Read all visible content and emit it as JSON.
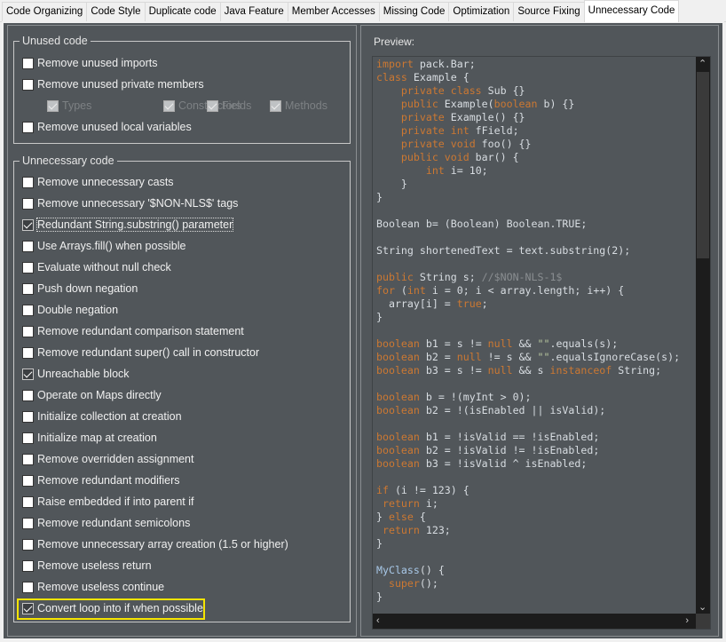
{
  "tabs": [
    "Code Organizing",
    "Code Style",
    "Duplicate code",
    "Java Feature",
    "Member Accesses",
    "Missing Code",
    "Optimization",
    "Source Fixing",
    "Unnecessary Code"
  ],
  "selected_tab": "Unnecessary Code",
  "unused": {
    "title": "Unused code",
    "items": [
      {
        "label": "Remove unused imports",
        "checked": false
      },
      {
        "label": "Remove unused private members",
        "checked": false
      },
      {
        "label": "Remove unused local variables",
        "checked": false
      }
    ],
    "sub": [
      {
        "label": "Types",
        "checked": true
      },
      {
        "label": "Constructors",
        "checked": true
      },
      {
        "label": "Fields",
        "checked": true
      },
      {
        "label": "Methods",
        "checked": true
      }
    ]
  },
  "unnecessary": {
    "title": "Unnecessary code",
    "items": [
      {
        "label": "Remove unnecessary casts",
        "checked": false
      },
      {
        "label": "Remove unnecessary '$NON-NLS$' tags",
        "checked": false
      },
      {
        "label": "Redundant String.substring() parameter",
        "checked": true
      },
      {
        "label": "Use Arrays.fill() when possible",
        "checked": false
      },
      {
        "label": "Evaluate without null check",
        "checked": false
      },
      {
        "label": "Push down negation",
        "checked": false
      },
      {
        "label": "Double negation",
        "checked": false
      },
      {
        "label": "Remove redundant comparison statement",
        "checked": false
      },
      {
        "label": "Remove redundant super() call in constructor",
        "checked": false
      },
      {
        "label": "Unreachable block",
        "checked": true
      },
      {
        "label": "Operate on Maps directly",
        "checked": false
      },
      {
        "label": "Initialize collection at creation",
        "checked": false
      },
      {
        "label": "Initialize map at creation",
        "checked": false
      },
      {
        "label": "Remove overridden assignment",
        "checked": false
      },
      {
        "label": "Remove redundant modifiers",
        "checked": false
      },
      {
        "label": "Raise embedded if into parent if",
        "checked": false
      },
      {
        "label": "Remove redundant semicolons",
        "checked": false
      },
      {
        "label": "Remove unnecessary array creation (1.5 or higher)",
        "checked": false
      },
      {
        "label": "Remove useless return",
        "checked": false
      },
      {
        "label": "Remove useless continue",
        "checked": false
      },
      {
        "label": "Convert loop into if when possible",
        "checked": true
      }
    ]
  },
  "preview": {
    "label": "Preview:",
    "lines": [
      [
        [
          "k",
          "import"
        ],
        [
          "t",
          " pack.Bar;"
        ]
      ],
      [
        [
          "k",
          "class"
        ],
        [
          "t",
          " Example {"
        ]
      ],
      [
        [
          "t",
          "    "
        ],
        [
          "k",
          "private class"
        ],
        [
          "t",
          " Sub {}"
        ]
      ],
      [
        [
          "t",
          "    "
        ],
        [
          "k",
          "public"
        ],
        [
          "t",
          " Example("
        ],
        [
          "k",
          "boolean"
        ],
        [
          "t",
          " b) {}"
        ]
      ],
      [
        [
          "t",
          "    "
        ],
        [
          "k",
          "private"
        ],
        [
          "t",
          " Example() {}"
        ]
      ],
      [
        [
          "t",
          "    "
        ],
        [
          "k",
          "private int"
        ],
        [
          "t",
          " fField;"
        ]
      ],
      [
        [
          "t",
          "    "
        ],
        [
          "k",
          "private void"
        ],
        [
          "t",
          " foo() {}"
        ]
      ],
      [
        [
          "t",
          "    "
        ],
        [
          "k",
          "public void"
        ],
        [
          "t",
          " bar() {"
        ]
      ],
      [
        [
          "t",
          "        "
        ],
        [
          "k",
          "int"
        ],
        [
          "t",
          " i= 10;"
        ]
      ],
      [
        [
          "t",
          "    }"
        ]
      ],
      [
        [
          "t",
          "}"
        ]
      ],
      [],
      [
        [
          "t",
          "Boolean b= (Boolean) Boolean.TRUE;"
        ]
      ],
      [],
      [
        [
          "t",
          "String shortenedText = text.substring(2);"
        ]
      ],
      [],
      [
        [
          "k",
          "public"
        ],
        [
          "t",
          " String s; "
        ],
        [
          "c",
          "//$NON-NLS-1$"
        ]
      ],
      [
        [
          "k",
          "for"
        ],
        [
          "t",
          " ("
        ],
        [
          "k",
          "int"
        ],
        [
          "t",
          " i = 0; i < array.length; i++) {"
        ]
      ],
      [
        [
          "t",
          "  array[i] = "
        ],
        [
          "k",
          "true"
        ],
        [
          "t",
          ";"
        ]
      ],
      [
        [
          "t",
          "}"
        ]
      ],
      [],
      [
        [
          "k",
          "boolean"
        ],
        [
          "t",
          " b1 = s != "
        ],
        [
          "k",
          "null"
        ],
        [
          "t",
          " && "
        ],
        [
          "s",
          "\"\""
        ],
        [
          "t",
          ".equals(s);"
        ]
      ],
      [
        [
          "k",
          "boolean"
        ],
        [
          "t",
          " b2 = "
        ],
        [
          "k",
          "null"
        ],
        [
          "t",
          " != s && "
        ],
        [
          "s",
          "\"\""
        ],
        [
          "t",
          ".equalsIgnoreCase(s);"
        ]
      ],
      [
        [
          "k",
          "boolean"
        ],
        [
          "t",
          " b3 = s != "
        ],
        [
          "k",
          "null"
        ],
        [
          "t",
          " && s "
        ],
        [
          "k",
          "instanceof"
        ],
        [
          "t",
          " String;"
        ]
      ],
      [],
      [
        [
          "k",
          "boolean"
        ],
        [
          "t",
          " b = !(myInt > 0);"
        ]
      ],
      [
        [
          "k",
          "boolean"
        ],
        [
          "t",
          " b2 = !(isEnabled || isValid);"
        ]
      ],
      [],
      [
        [
          "k",
          "boolean"
        ],
        [
          "t",
          " b1 = !isValid == !isEnabled;"
        ]
      ],
      [
        [
          "k",
          "boolean"
        ],
        [
          "t",
          " b2 = !isValid != !isEnabled;"
        ]
      ],
      [
        [
          "k",
          "boolean"
        ],
        [
          "t",
          " b3 = !isValid ^ isEnabled;"
        ]
      ],
      [],
      [
        [
          "k",
          "if"
        ],
        [
          "t",
          " (i != 123) {"
        ]
      ],
      [
        [
          "t",
          " "
        ],
        [
          "k",
          "return"
        ],
        [
          "t",
          " i;"
        ]
      ],
      [
        [
          "t",
          "} "
        ],
        [
          "k",
          "else"
        ],
        [
          "t",
          " {"
        ]
      ],
      [
        [
          "t",
          " "
        ],
        [
          "k",
          "return"
        ],
        [
          "t",
          " 123;"
        ]
      ],
      [
        [
          "t",
          "}"
        ]
      ],
      [],
      [
        [
          "m",
          "MyClass"
        ],
        [
          "t",
          "() {"
        ]
      ],
      [
        [
          "t",
          "  "
        ],
        [
          "k",
          "super"
        ],
        [
          "t",
          "();"
        ]
      ],
      [
        [
          "t",
          "}"
        ]
      ]
    ]
  },
  "colors": {
    "background": "#51565a",
    "keyword": "#cc7832",
    "highlight": "#f5e400"
  }
}
